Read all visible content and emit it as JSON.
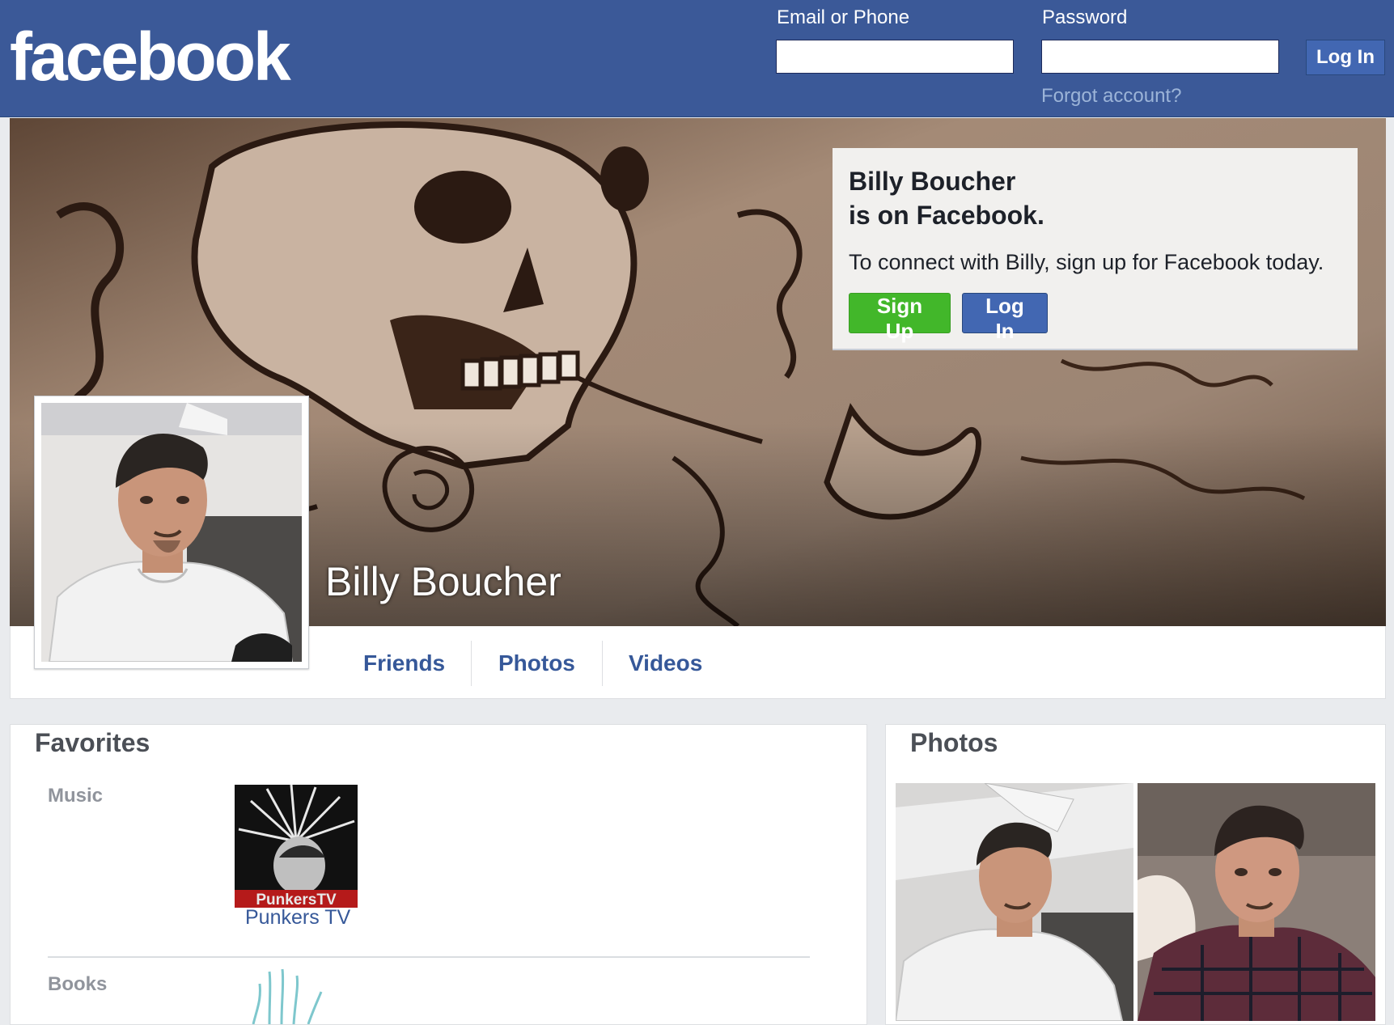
{
  "header": {
    "logo": "facebook",
    "email_label": "Email or Phone",
    "password_label": "Password",
    "login_button": "Log In",
    "forgot_link": "Forgot account?"
  },
  "profile": {
    "name": "Billy Boucher"
  },
  "signup_card": {
    "title_line1": "Billy Boucher",
    "title_line2": "is on Facebook.",
    "text": "To connect with Billy, sign up for Facebook today.",
    "signup_button": "Sign Up",
    "login_button": "Log In"
  },
  "nav": {
    "tabs": [
      {
        "label": "Friends"
      },
      {
        "label": "Photos"
      },
      {
        "label": "Videos"
      }
    ]
  },
  "favorites": {
    "title": "Favorites",
    "categories": [
      {
        "label": "Music",
        "items": [
          {
            "name": "Punkers TV",
            "image_text": "PunkersTV"
          }
        ]
      },
      {
        "label": "Books"
      }
    ]
  },
  "photos_panel": {
    "title": "Photos"
  },
  "colors": {
    "brand_blue": "#3b5998",
    "button_blue": "#4267b2",
    "signup_green": "#42b72a",
    "link_blue": "#365899"
  }
}
